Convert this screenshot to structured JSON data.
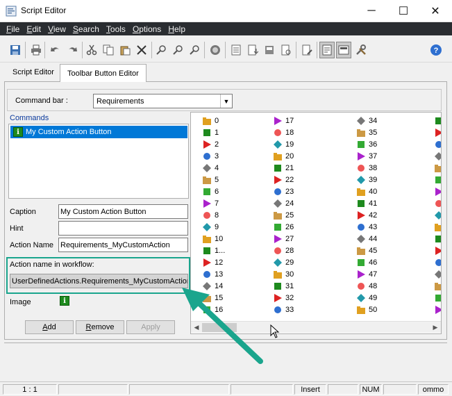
{
  "window": {
    "title": "Script Editor",
    "minimize": "─",
    "maximize": "☐",
    "close": "✕"
  },
  "menu": [
    {
      "u": "F",
      "rest": "ile"
    },
    {
      "u": "E",
      "rest": "dit"
    },
    {
      "u": "V",
      "rest": "iew"
    },
    {
      "u": "S",
      "rest": "earch"
    },
    {
      "u": "T",
      "rest": "ools"
    },
    {
      "u": "O",
      "rest": "ptions"
    },
    {
      "u": "H",
      "rest": "elp"
    }
  ],
  "tabs": {
    "script_editor": "Script Editor",
    "toolbar_button_editor": "Toolbar Button Editor"
  },
  "command_bar": {
    "label": "Command bar :",
    "value": "Requirements"
  },
  "commands": {
    "label": "Commands",
    "items": [
      "My Custom Action Button"
    ]
  },
  "form": {
    "caption_label": "Caption",
    "caption_value": "My Custom Action Button",
    "hint_label": "Hint",
    "hint_value": "",
    "action_name_label": "Action Name",
    "action_name_value": "Requirements_MyCustomAction",
    "workflow_label": "Action name in workflow:",
    "workflow_value": "UserDefinedActions.Requirements_MyCustomAction",
    "image_label": "Image"
  },
  "buttons": {
    "add": "Add",
    "add_u": "A",
    "remove": "Remove",
    "remove_u": "R",
    "apply": "Apply"
  },
  "icon_grid": {
    "col1": [
      "0",
      "1",
      "2",
      "3",
      "4",
      "5",
      "6",
      "7",
      "8",
      "9",
      "10",
      "1...",
      "12",
      "13",
      "14",
      "15",
      "16"
    ],
    "col2": [
      "17",
      "18",
      "19",
      "20",
      "21",
      "22",
      "23",
      "24",
      "25",
      "26",
      "27",
      "28",
      "29",
      "30",
      "31",
      "32",
      "33"
    ],
    "col3": [
      "34",
      "35",
      "36",
      "37",
      "38",
      "39",
      "40",
      "41",
      "42",
      "43",
      "44",
      "45",
      "46",
      "47",
      "48",
      "49",
      "50"
    ]
  },
  "status": {
    "position": "1 : 1",
    "mode": "Insert",
    "num": "NUM",
    "comm": "ommo"
  },
  "colors": {
    "menubar": "#2a2d31",
    "selection": "#0078d7",
    "annotation": "#1aa58d"
  }
}
